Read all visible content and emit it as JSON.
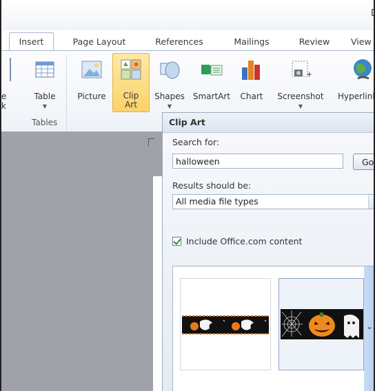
{
  "window": {
    "title_fragment": "D"
  },
  "tabs": [
    {
      "label": "Insert",
      "active": true
    },
    {
      "label": "Page Layout"
    },
    {
      "label": "References"
    },
    {
      "label": "Mailings"
    },
    {
      "label": "Review"
    },
    {
      "label": "View"
    }
  ],
  "ribbon": {
    "left_partial_labels": [
      "e",
      "k"
    ],
    "buttons": [
      {
        "label": "Table",
        "icon": "table-icon",
        "has_arrow": true
      },
      {
        "label": "Picture",
        "icon": "picture-icon"
      },
      {
        "label": "Clip Art",
        "label_line1": "Clip",
        "label_line2": "Art",
        "icon": "clip-art-icon",
        "selected": true
      },
      {
        "label": "Shapes",
        "icon": "shapes-icon",
        "has_arrow": true
      },
      {
        "label": "SmartArt",
        "icon": "smartart-icon"
      },
      {
        "label": "Chart",
        "icon": "chart-icon"
      },
      {
        "label": "Screenshot",
        "icon": "screenshot-icon",
        "has_arrow": true
      },
      {
        "label": "Hyperlink",
        "icon": "hyperlink-icon"
      }
    ],
    "groups": [
      {
        "label": "Tables"
      }
    ]
  },
  "clip_art_pane": {
    "title": "Clip Art",
    "search_label": "Search for:",
    "search_value": "halloween",
    "go_label": "Go",
    "results_label": "Results should be:",
    "media_types_value": "All media file types",
    "include_office_label": "Include Office.com content",
    "include_office_checked": true,
    "results": [
      {
        "name": "halloween-ghost-border-thumbnail"
      },
      {
        "name": "halloween-pumpkin-ghost-thumbnail",
        "selected": true
      }
    ]
  },
  "colors": {
    "accent": "#fbd26a",
    "ribbon_border": "#a9b8cf",
    "doc_background": "#9fa3a9"
  }
}
